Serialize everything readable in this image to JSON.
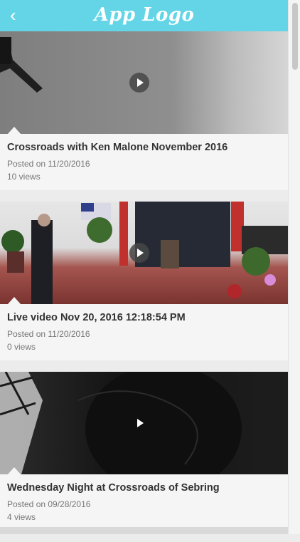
{
  "header": {
    "back_glyph": "‹",
    "logo_text": "App Logo",
    "accent_color": "#63d5e7"
  },
  "videos": [
    {
      "title": "Crossroads with Ken Malone November 2016",
      "posted": "Posted on 11/20/2016",
      "views": "10 views"
    },
    {
      "title": "Live video Nov 20, 2016 12:18:54 PM",
      "posted": "Posted on 11/20/2016",
      "views": "0 views"
    },
    {
      "title": "Wednesday Night at Crossroads of Sebring",
      "posted": "Posted on 09/28/2016",
      "views": "4 views"
    }
  ],
  "icons": {
    "back": "chevron-left-icon",
    "play": "play-icon"
  }
}
